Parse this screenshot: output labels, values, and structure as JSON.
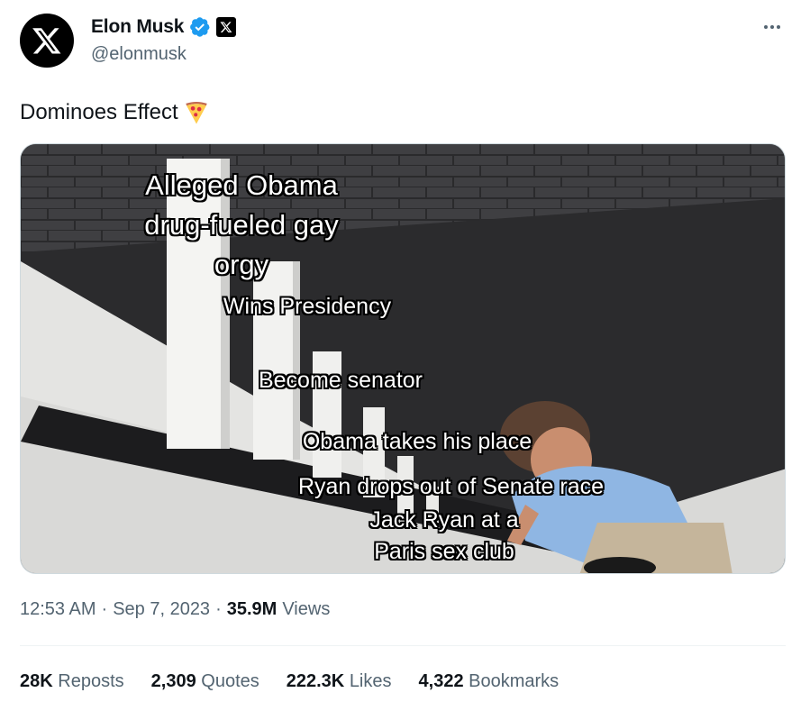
{
  "author": {
    "display_name": "Elon Musk",
    "handle": "@elonmusk",
    "verified_icon": "verified-badge-icon",
    "affiliation_icon": "x-logo-icon",
    "avatar_icon": "x-logo-icon"
  },
  "tweet": {
    "text": "Dominoes Effect",
    "emoji": "pizza-icon"
  },
  "media": {
    "captions": {
      "c1_line1": "Alleged Obama",
      "c1_line2": "drug-fueled gay",
      "c1_line3": "orgy",
      "c2": "Wins Presidency",
      "c3": "Become senator",
      "c4": "Obama takes his place",
      "c5": "Ryan drops out of Senate race",
      "c6_line1": "Jack Ryan at a",
      "c6_line2": "Paris sex club"
    }
  },
  "meta": {
    "time": "12:53 AM",
    "sep1": "·",
    "date": "Sep 7, 2023",
    "sep2": "·",
    "views_count": "35.9M",
    "views_label": "Views"
  },
  "stats": {
    "reposts_count": "28K",
    "reposts_label": "Reposts",
    "quotes_count": "2,309",
    "quotes_label": "Quotes",
    "likes_count": "222.3K",
    "likes_label": "Likes",
    "bookmarks_count": "4,322",
    "bookmarks_label": "Bookmarks"
  },
  "colors": {
    "text_primary": "#0f1419",
    "text_secondary": "#536471",
    "verified_blue": "#1d9bf0",
    "divider": "#eff3f4"
  }
}
